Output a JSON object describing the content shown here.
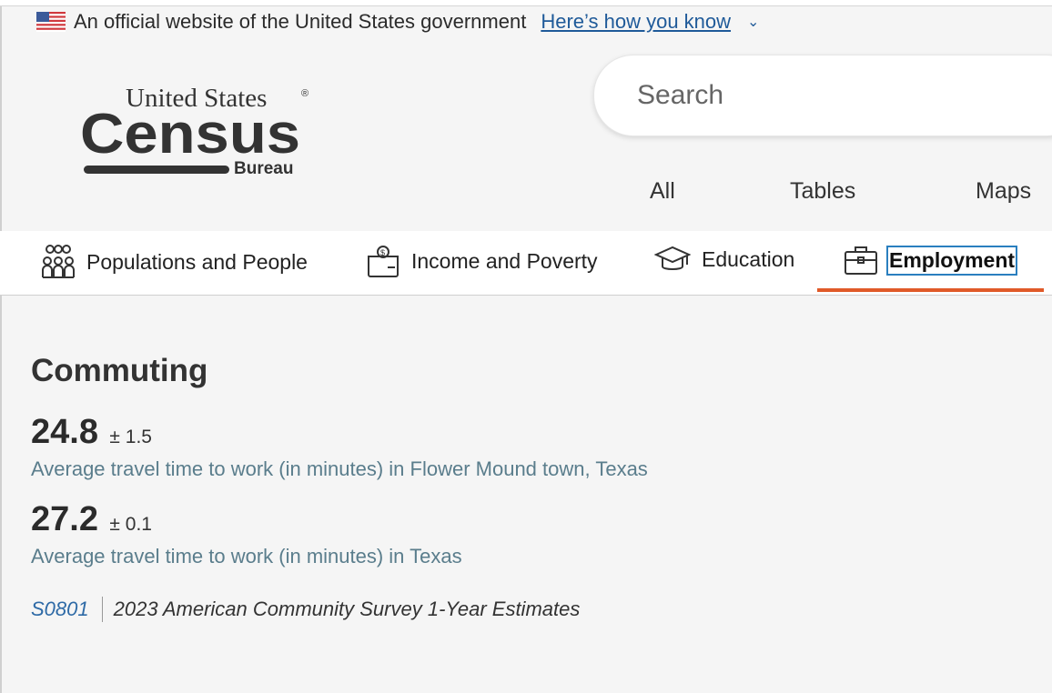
{
  "gov_banner": {
    "text": "An official website of the United States government",
    "link": "Here’s how you know"
  },
  "logo": {
    "line1": "United States",
    "line2": "Census",
    "line3": "Bureau",
    "mark": "®"
  },
  "search": {
    "placeholder": "Search",
    "tabs": [
      "All",
      "Tables",
      "Maps"
    ]
  },
  "topics": [
    {
      "label": "Populations and People",
      "icon": "people-group-icon"
    },
    {
      "label": "Income and Poverty",
      "icon": "money-bag-icon"
    },
    {
      "label": "Education",
      "icon": "graduation-cap-icon"
    },
    {
      "label": "Employment",
      "icon": "briefcase-icon",
      "active": true
    }
  ],
  "section": {
    "title": "Commuting",
    "stats": [
      {
        "value": "24.8",
        "moe": "± 1.5",
        "description": "Average travel time to work (in minutes) in Flower Mound town, Texas"
      },
      {
        "value": "27.2",
        "moe": "± 0.1",
        "description": "Average travel time to work (in minutes) in Texas"
      }
    ],
    "source_code": "S0801",
    "source_name": "2023 American Community Survey 1-Year Estimates"
  },
  "colors": {
    "accent_underline": "#e05a28",
    "link": "#1f5a99",
    "description": "#5a7d8c"
  }
}
